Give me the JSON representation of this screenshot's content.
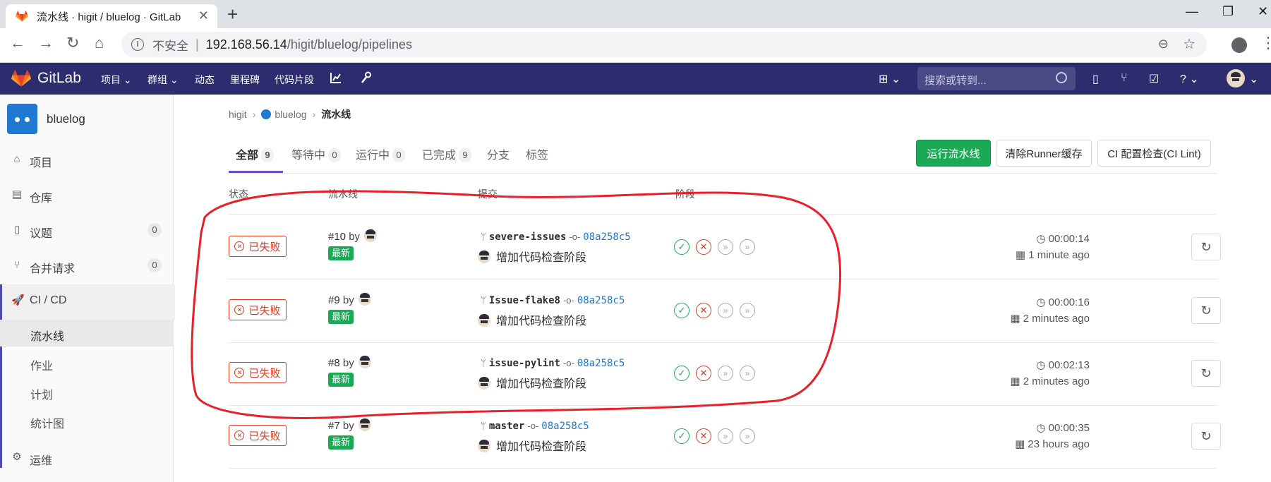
{
  "browser": {
    "tab_title": "流水线 · higit / bluelog · GitLab",
    "tab_close": "✕",
    "new_tab": "+",
    "window_controls": [
      "—",
      "❐",
      "✕"
    ],
    "nav_icons": [
      "←",
      "→",
      "↻",
      "⌂"
    ],
    "security_label": "不安全",
    "separator": "|",
    "url_host": "192.168.56.14",
    "url_path": "/higit/bluelog/pipelines",
    "zoom_icon": "⊖",
    "star_icon": "☆",
    "menu_icon": "⋮"
  },
  "gitlab_header": {
    "brand": "GitLab",
    "nav": [
      "项目 ⌄",
      "群组 ⌄",
      "动态",
      "里程碑",
      "代码片段"
    ],
    "icons": [
      "chart-icon",
      "wrench-icon"
    ],
    "search_placeholder": "搜索或转到...",
    "right_icons": [
      "⊞ ⌄",
      "▯",
      "⑂",
      "☑",
      "? ⌄",
      "⌄"
    ]
  },
  "sidebar": {
    "project_name": "bluelog",
    "items": [
      {
        "label": "项目",
        "icon": "home-icon"
      },
      {
        "label": "仓库",
        "icon": "doc-icon"
      },
      {
        "label": "议题",
        "icon": "issues-icon",
        "count": "0"
      },
      {
        "label": "合并请求",
        "icon": "merge-icon",
        "count": "0"
      },
      {
        "label": "CI / CD",
        "icon": "rocket-icon"
      }
    ],
    "sub_items": [
      "流水线",
      "作业",
      "计划",
      "统计图"
    ],
    "bottom_item": "运维"
  },
  "breadcrumb": [
    "higit",
    "bluelog",
    "流水线"
  ],
  "tabs": [
    {
      "label": "全部",
      "count": "9"
    },
    {
      "label": "等待中",
      "count": "0"
    },
    {
      "label": "运行中",
      "count": "0"
    },
    {
      "label": "已完成",
      "count": "9"
    },
    {
      "label": "分支"
    },
    {
      "label": "标签"
    }
  ],
  "buttons": {
    "run": "运行流水线",
    "clear_cache": "清除Runner缓存",
    "lint": "CI 配置检查(CI Lint)"
  },
  "table": {
    "headers": [
      "状态",
      "流水线",
      "提交",
      "阶段"
    ],
    "rows": [
      {
        "status": "已失败",
        "id": "#10",
        "by": "by",
        "badge": "最新",
        "branch": "severe-issues",
        "sha": "08a258c5",
        "message": "增加代码检查阶段",
        "duration": "00:00:14",
        "finished": "1 minute ago"
      },
      {
        "status": "已失败",
        "id": "#9",
        "by": "by",
        "badge": "最新",
        "branch": "Issue-flake8",
        "sha": "08a258c5",
        "message": "增加代码检查阶段",
        "duration": "00:00:16",
        "finished": "2 minutes ago"
      },
      {
        "status": "已失败",
        "id": "#8",
        "by": "by",
        "badge": "最新",
        "branch": "issue-pylint",
        "sha": "08a258c5",
        "message": "增加代码检查阶段",
        "duration": "00:02:13",
        "finished": "2 minutes ago"
      },
      {
        "status": "已失败",
        "id": "#7",
        "by": "by",
        "badge": "最新",
        "branch": "master",
        "sha": "08a258c5",
        "message": "增加代码检查阶段",
        "duration": "00:00:35",
        "finished": "23 hours ago"
      }
    ],
    "stage_states": [
      "success",
      "failed",
      "skipped",
      "skipped"
    ]
  },
  "colors": {
    "header_bg": "#2c2c6e",
    "success": "#1aaa55",
    "failed": "#db3b21",
    "link": "#1f78d1",
    "annotation": "#e8202a"
  }
}
